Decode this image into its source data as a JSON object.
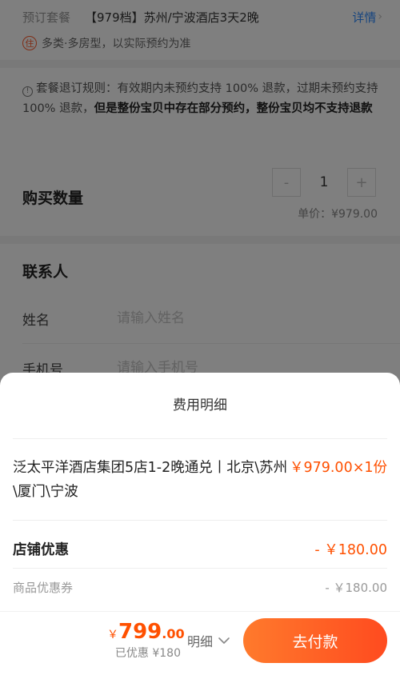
{
  "package": {
    "label": "预订套餐",
    "name": "【979档】苏州/宁波酒店3天2晚",
    "detail_link": "详情",
    "badge": "住",
    "room_note": "多类·多房型，以实际预约为准"
  },
  "refund": {
    "prefix": "套餐退订规则：有效期内未预约支持 100% 退款，过期未预约支持 100% 退款，",
    "bold": "但是整份宝贝中存在部分预约，整份宝贝均不支持退款"
  },
  "quantity": {
    "label": "购买数量",
    "minus": "-",
    "value": "1",
    "plus": "+",
    "unit_price": "单价：¥979.00"
  },
  "contact": {
    "title": "联系人",
    "name_label": "姓名",
    "name_placeholder": "请输入姓名",
    "phone_label": "手机号",
    "phone_placeholder": "请输入手机号"
  },
  "sheet": {
    "title": "费用明细",
    "item_name": "泛太平洋酒店集团5店1-2晚通兑丨北京\\苏州\\厦门\\宁波",
    "item_price": "￥979.00×1份",
    "shop_discount_label": "店铺优惠",
    "shop_discount_amount": "- ￥180.00",
    "coupon_label": "商品优惠券",
    "coupon_amount": "- ￥180.00"
  },
  "footer": {
    "currency": "￥",
    "total_int": "799",
    "total_dec": ".00",
    "saved": "已优惠 ¥180",
    "detail_toggle": "明细",
    "pay_button": "去付款"
  },
  "colors": {
    "accent": "#ff5000",
    "link": "#2f8bff",
    "overlay": "rgba(0,0,0,0.5)"
  }
}
